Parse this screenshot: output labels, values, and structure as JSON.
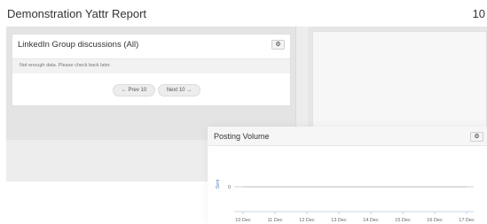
{
  "header": {
    "title": "Demonstration Yattr Report",
    "corner_number": "10"
  },
  "linkedin_panel": {
    "title": "LinkedIn Group discussions (All)",
    "settings_icon": "gear-icon",
    "notice": "Not enough data. Please check back later.",
    "prev_label": "← Prev 10",
    "next_label": "Next 10 →"
  },
  "posting_panel": {
    "title": "Posting Volume",
    "settings_icon": "gear-icon"
  },
  "chart_data": {
    "type": "line",
    "title": "Posting Volume",
    "ylabel": "Sent",
    "xlabel": "",
    "categories": [
      "10 Dec",
      "11 Dec",
      "12 Dec",
      "13 Dec",
      "14 Dec",
      "15 Dec",
      "16 Dec",
      "17 Dec"
    ],
    "y_ticks": [
      "0"
    ],
    "series": [
      {
        "values": [
          0,
          0,
          0,
          0,
          0,
          0,
          0,
          0
        ]
      }
    ],
    "colors": {
      "series": "#bdbdbd",
      "axis_label": "#4a7fb0"
    },
    "grid": true,
    "legend": "none"
  }
}
